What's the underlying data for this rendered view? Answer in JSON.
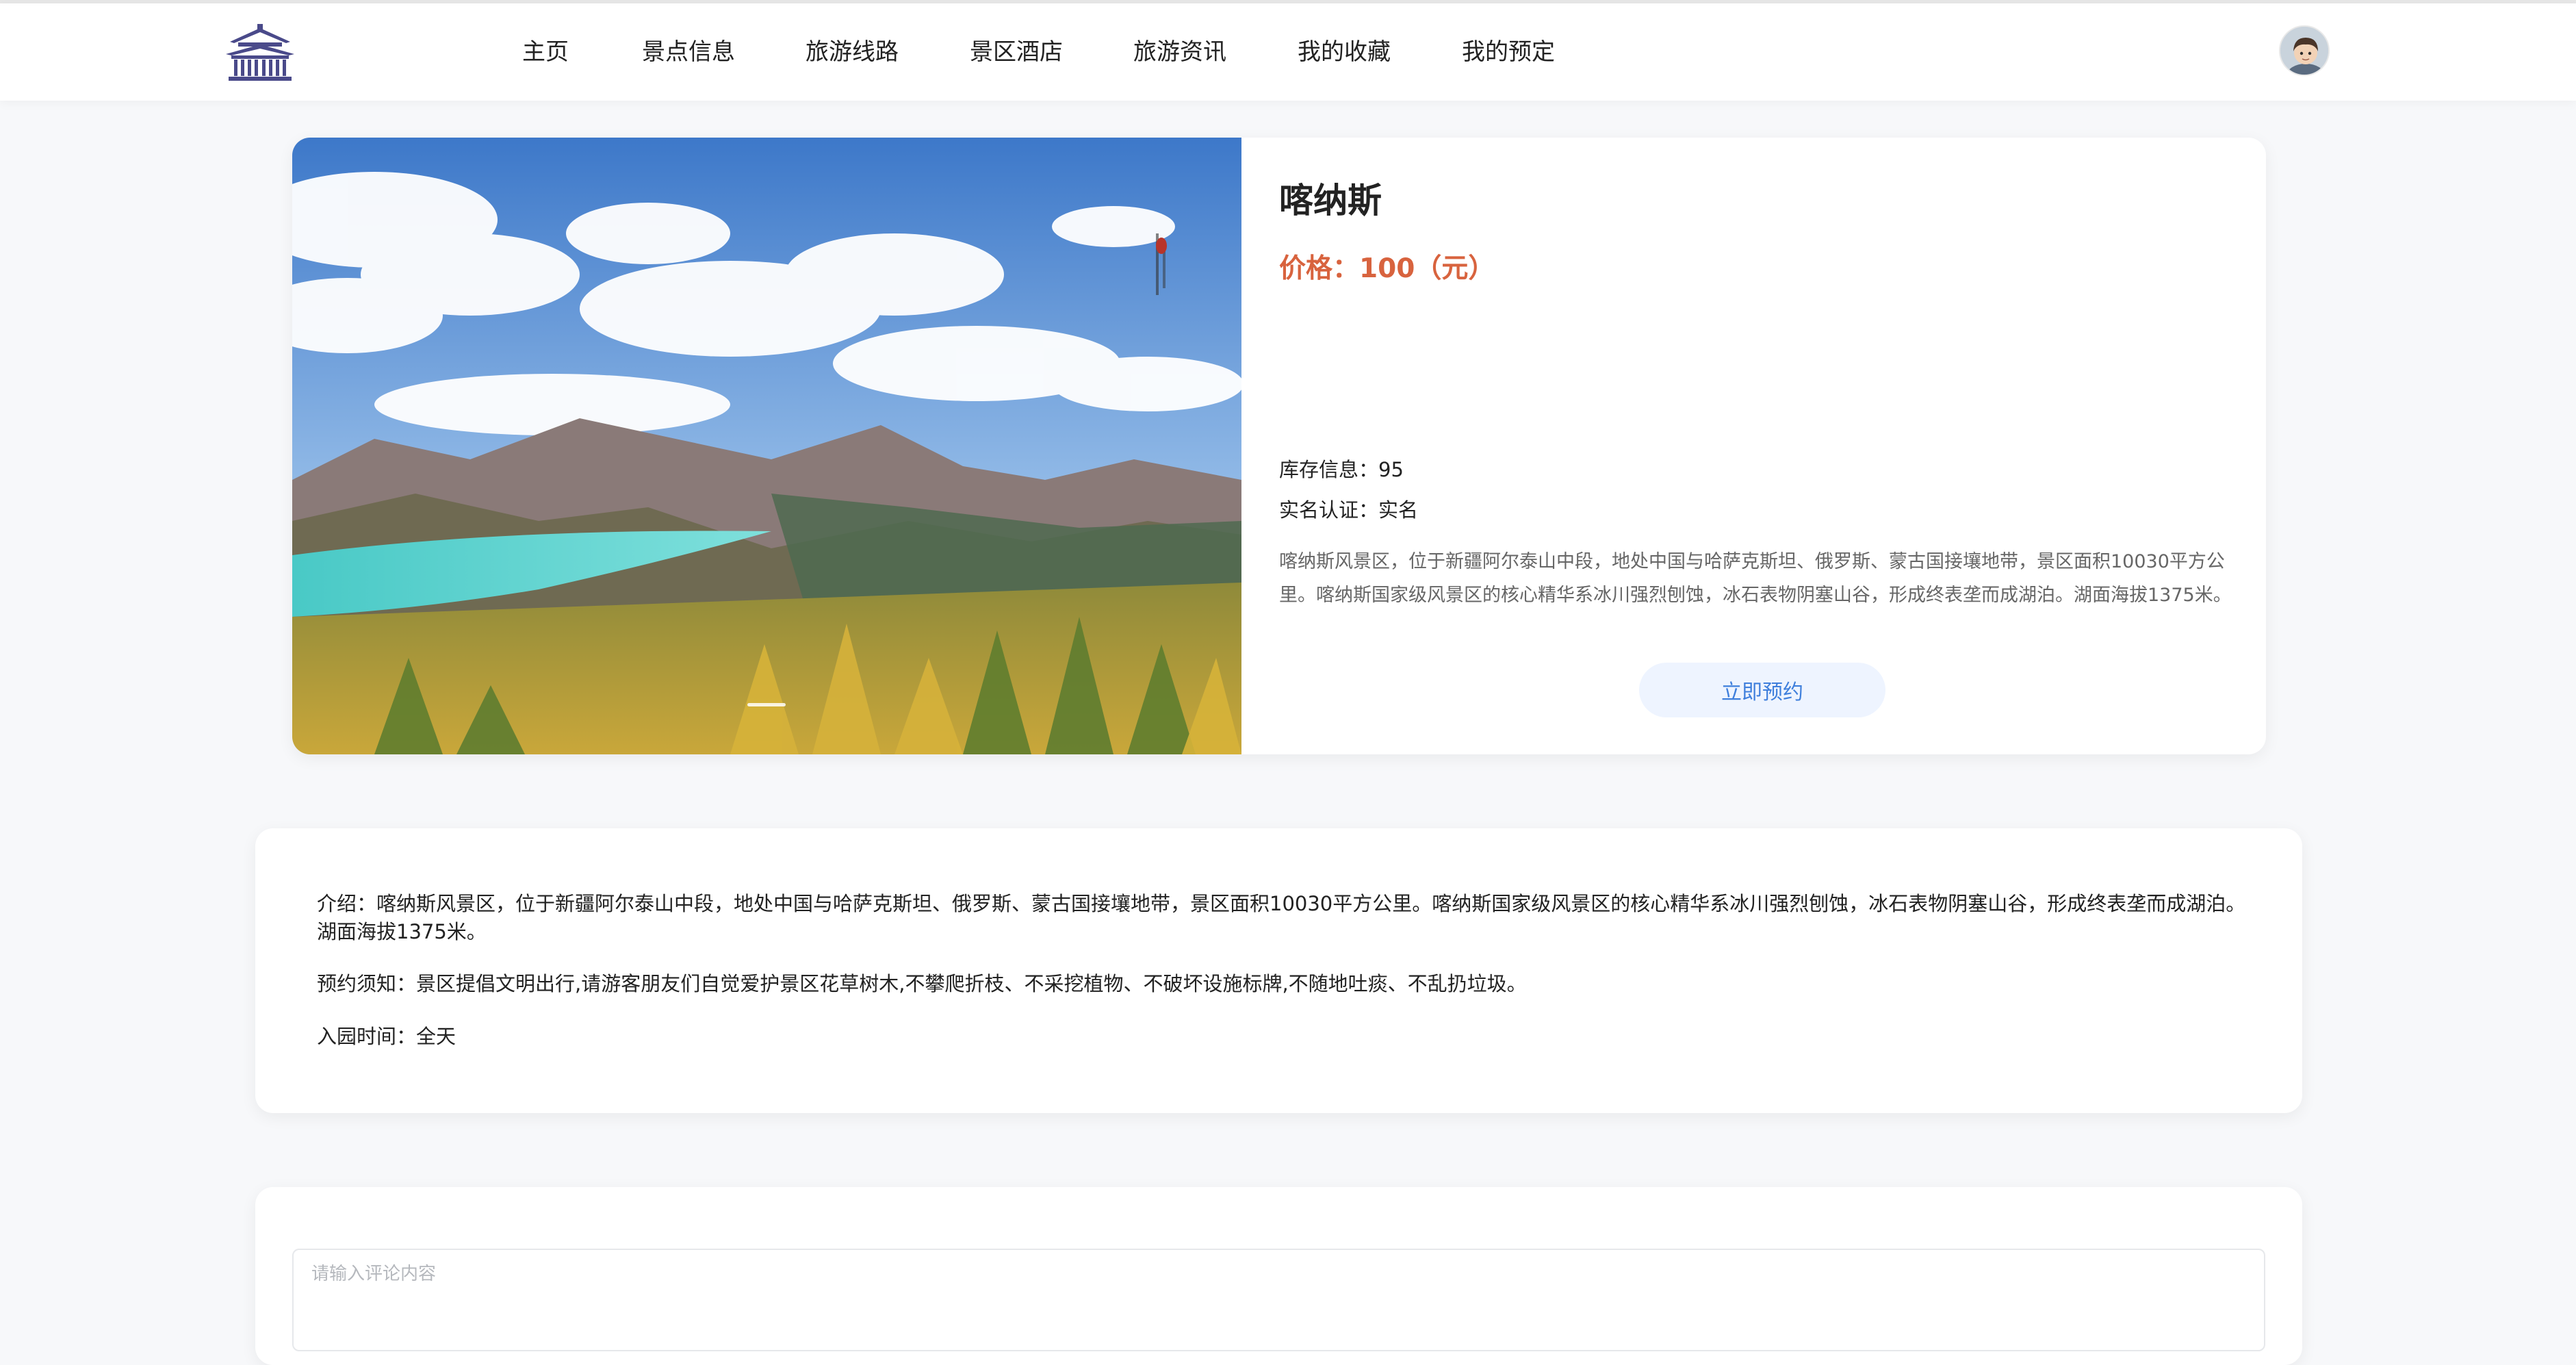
{
  "nav": {
    "items": [
      {
        "label": "主页"
      },
      {
        "label": "景点信息"
      },
      {
        "label": "旅游线路"
      },
      {
        "label": "景区酒店"
      },
      {
        "label": "旅游资讯"
      },
      {
        "label": "我的收藏"
      },
      {
        "label": "我的预定"
      }
    ]
  },
  "spot": {
    "title": "喀纳斯",
    "price": "价格：100（元）",
    "stock": "库存信息：95",
    "realname": "实名认证：实名",
    "summary": "喀纳斯风景区，位于新疆阿尔泰山中段，地处中国与哈萨克斯坦、俄罗斯、蒙古国接壤地带，景区面积10030平方公里。喀纳斯国家级风景区的核心精华系冰川强烈刨蚀，冰石表物阴塞山谷，形成终表垄而成湖泊。湖面海拔1375米。",
    "book_label": "立即预约"
  },
  "details": {
    "intro": "介绍：喀纳斯风景区，位于新疆阿尔泰山中段，地处中国与哈萨克斯坦、俄罗斯、蒙古国接壤地带，景区面积10030平方公里。喀纳斯国家级风景区的核心精华系冰川强烈刨蚀，冰石表物阴塞山谷，形成终表垄而成湖泊。湖面海拔1375米。",
    "notice": "预约须知：景区提倡文明出行,请游客朋友们自觉爱护景区花草树木,不攀爬折枝、不采挖植物、不破坏设施标牌,不随地吐痰、不乱扔垃圾。",
    "open_time": "入园时间：全天"
  },
  "comment": {
    "placeholder": "请输入评论内容"
  },
  "colors": {
    "price": "#d8633e",
    "book_button_bg": "#eef4ff",
    "book_button_text": "#3f7fdc",
    "logo": "#4a4a8a"
  }
}
